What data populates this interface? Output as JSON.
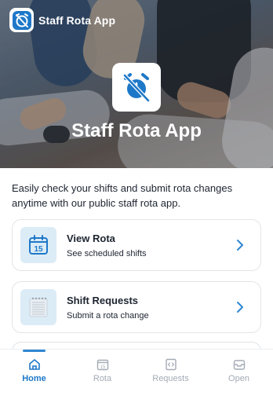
{
  "app": {
    "title": "Staff Rota App"
  },
  "hero": {
    "title": "Staff Rota App"
  },
  "intro": {
    "text": "Easily check your shifts and submit rota changes anytime with our public staff rota app."
  },
  "cards": [
    {
      "title": "View Rota",
      "subtitle": "See scheduled shifts",
      "icon": "calendar-15-icon"
    },
    {
      "title": "Shift Requests",
      "subtitle": "Submit a rota change",
      "icon": "notepad-icon"
    }
  ],
  "nav": [
    {
      "label": "Home",
      "icon": "home-icon",
      "active": true
    },
    {
      "label": "Rota",
      "icon": "calendar-icon",
      "active": false
    },
    {
      "label": "Requests",
      "icon": "code-doc-icon",
      "active": false
    },
    {
      "label": "Open",
      "icon": "inbox-icon",
      "active": false
    }
  ],
  "colors": {
    "accent": "#1e78c8",
    "chevron": "#2f86d2",
    "iconBg": "#dcecf7",
    "inactive": "#a4abb5"
  },
  "calendar_number": "15"
}
